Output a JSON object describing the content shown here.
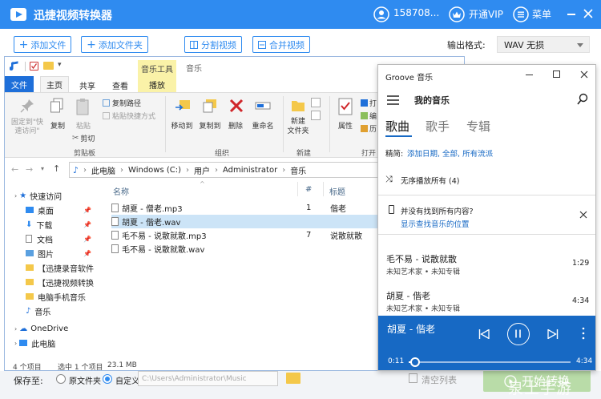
{
  "app": {
    "title": "迅捷视频转换器",
    "user_id": "158708...",
    "vip_label": "开通VIP",
    "menu_label": "菜单",
    "toolbar": {
      "add_file": "添加文件",
      "add_folder": "添加文件夹",
      "split_video": "分割视频",
      "merge_video": "合并视频",
      "output_format_label": "输出格式:",
      "output_format_value": "WAV  无损"
    },
    "bottom": {
      "save_label": "保存至:",
      "option_original": "原文件夹",
      "option_custom": "自定义",
      "path_placeholder": "C:\\Users\\Administrator\\Music",
      "clear_list": "清空列表",
      "start": "开始转换",
      "watermark": "泉土手游"
    }
  },
  "explorer": {
    "context_group": "音乐工具",
    "window_title": "音乐",
    "tabs": {
      "file": "文件",
      "home": "主页",
      "share": "共享",
      "view": "查看",
      "play": "播放"
    },
    "ribbon": {
      "pin_quick": "固定到\"快\n速访问\"",
      "copy": "复制",
      "paste": "粘贴",
      "copy_path": "复制路径",
      "paste_shortcut": "粘贴快捷方式",
      "cut": "剪切",
      "clipboard_group": "剪贴板",
      "move_to": "移动到",
      "copy_to": "复制到",
      "delete": "删除",
      "rename": "重命名",
      "organize_group": "组织",
      "new_folder": "新建\n文件夹",
      "new_group": "新建",
      "properties": "属性",
      "open_group": "打开",
      "open_small_1": "打",
      "open_small_2": "编",
      "open_small_3": "历"
    },
    "address": [
      "此电脑",
      "Windows (C:)",
      "用户",
      "Administrator",
      "音乐"
    ],
    "nav": [
      {
        "label": "快速访问",
        "pinned": false
      },
      {
        "label": "桌面",
        "pinned": true
      },
      {
        "label": "下载",
        "pinned": true
      },
      {
        "label": "文档",
        "pinned": true
      },
      {
        "label": "图片",
        "pinned": true
      },
      {
        "label": "【迅捷录音软件",
        "pinned": false
      },
      {
        "label": "【迅捷视频转换",
        "pinned": false
      },
      {
        "label": "电脑手机音乐",
        "pinned": false
      },
      {
        "label": "音乐",
        "pinned": false
      },
      {
        "label": "OneDrive",
        "pinned": false
      },
      {
        "label": "此电脑",
        "pinned": false
      }
    ],
    "columns": {
      "name": "名称",
      "num": "#",
      "title": "标题"
    },
    "files": [
      {
        "name": "胡夏 - 僧老.mp3",
        "num": "1",
        "title": "偕老",
        "selected": false
      },
      {
        "name": "胡夏 - 偕老.wav",
        "num": "",
        "title": "",
        "selected": true
      },
      {
        "name": "毛不易 - 说散就散.mp3",
        "num": "7",
        "title": "说散就散",
        "selected": false
      },
      {
        "name": "毛不易 - 说散就散.wav",
        "num": "",
        "title": "",
        "selected": false
      }
    ],
    "status": {
      "count": "4 个项目",
      "selection": "选中 1 个项目",
      "size": "23.1 MB"
    }
  },
  "groove": {
    "title": "Groove 音乐",
    "heading": "我的音乐",
    "tabs": [
      "歌曲",
      "歌手",
      "专辑"
    ],
    "sort_label": "精简:",
    "sort_options": "添加日期, 全部, 所有流派",
    "shuffle": "无序播放所有 (4)",
    "notice_title": "并没有找到所有内容?",
    "notice_link": "显示查找音乐的位置",
    "songs": [
      {
        "title": "毛不易 - 说散就散",
        "meta": "未知艺术家 • 未知专辑",
        "duration": "1:29"
      },
      {
        "title": "胡夏 - 偕老",
        "meta": "未知艺术家 • 未知专辑",
        "duration": "4:34"
      }
    ],
    "now_playing": {
      "title": "胡夏 - 偕老",
      "elapsed": "0:11",
      "total": "4:34",
      "progress": 0.04
    }
  },
  "colors": {
    "brand_blue": "#2f8bf0",
    "explorer_blue": "#1e6fd9",
    "groove_player": "#1769c4",
    "start_green": "#b9dca8"
  }
}
